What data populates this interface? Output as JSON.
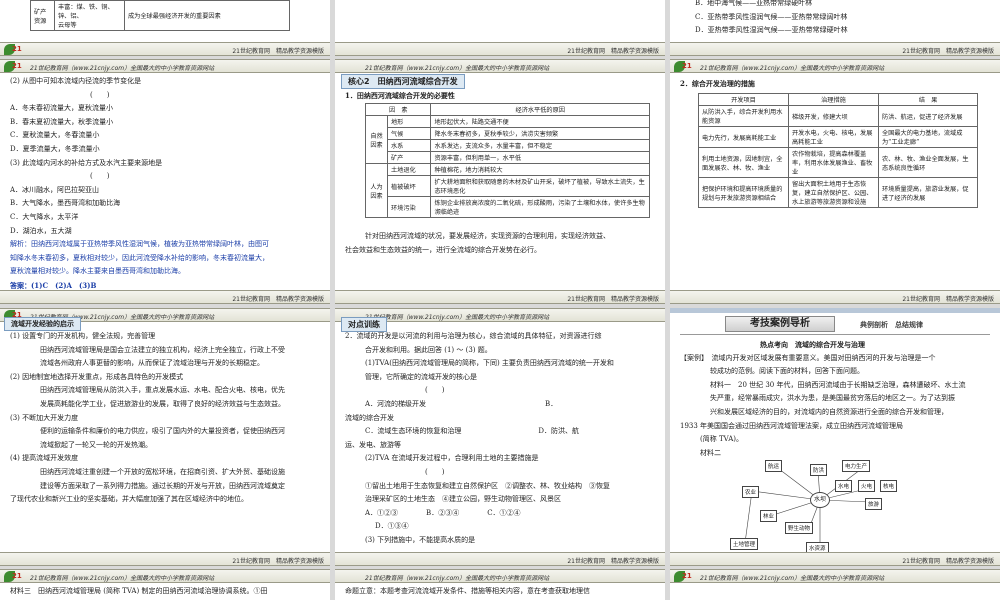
{
  "banner": {
    "logo_text": "21",
    "url": "21世纪教育网（www.21cnjy.com）全国最大的中小学教育资源网站",
    "right": "21世纪教育网　精品教学资源模版"
  },
  "s1": {
    "row_a": "矿产",
    "row_b": "资源",
    "row_c": "丰富：煤、铁、铜、锌、铝、",
    "row_d": "云母等",
    "row_e": "成为全球最强经济开发的重要因素"
  },
  "s2": {
    "lines": [
      "B．地中海气候——亚热带常绿硬叶林",
      "C．亚热带季风性湿润气候——亚热带常绿阔叶林",
      "D．亚热带季风性湿润气候——亚热带常绿硬叶林"
    ]
  },
  "s3": {
    "lines": [
      "(2) 从图中可知本流域内径流的季节变化是",
      "(　　)",
      "A．冬末春初流量大，夏秋流量小",
      "B．春末夏初流量大，秋季流量小",
      "C．夏秋流量大，冬春流量小",
      "D．夏季流量大，冬季流量小",
      "(3) 此流域内河水的补给方式及水汽主要来源地是",
      "(　　)",
      "A．冰川融水，阿巴拉契亚山",
      "B．大气降水，墨西哥湾和加勒比海",
      "C．大气降水，太平洋",
      "D．湖泊水，五大湖",
      "解析：田纳西河流域属于亚热带季风性湿润气候，植被为亚热带常绿阔叶林，由图可",
      "知降水冬末春初多，夏秋相对较少，因此河流受降水补给的影响，冬末春初流量大，",
      "夏秋流量相对较少。降水主要来自墨西哥湾和加勒比海。",
      "答案：(1)C　(2)A　(3)B"
    ]
  },
  "s4": {
    "label": "核心2　田纳西河流域综合开发",
    "heading": "1．田纳西河流域综合开发的必要性",
    "table": {
      "h1": "因　素",
      "h2": "经济水平低的原因",
      "g1": "自然因素",
      "g2": "人为因素",
      "rows": [
        [
          "地形",
          "地形起伏大，陆路交通不便"
        ],
        [
          "气候",
          "降水冬末春初多，夏秋季较少，洪涝灾害频繁"
        ],
        [
          "水系",
          "水系发达，支流众多，水量丰富，但不稳定"
        ],
        [
          "矿产",
          "资源丰富，但利用单一，水平低"
        ],
        [
          "土地退化",
          "种植棉花，地力消耗较大"
        ],
        [
          "植被破坏",
          "扩大耕地面积和获取随意的木材及矿山开采，破坏了植被，导致水土流失，生态环境恶化"
        ],
        [
          "环境污染",
          "炼铜企业排放高浓度的二氧化硫，形成酸雨，污染了土壤和水体，使许多生物濒临绝迹"
        ]
      ]
    },
    "after": [
      "针对田纳西河流域的状况，要发展经济，实现资源的合理利用，实现经济效益、",
      "社会效益和生态效益的统一，进行全流域的综合开发势在必行。"
    ]
  },
  "s5": {
    "heading": "2．综合开发治理的措施",
    "table": {
      "h": [
        "开发项目",
        "治理措施",
        "结　果"
      ],
      "rows": [
        [
          "从防洪入手，综合开发利用水能资源",
          "梯级开发，修建大坝",
          "防洪、航运，促进了经济发展"
        ],
        [
          "电力先行，发展高耗能工业",
          "开发水电，火电、核电，发展高耗能工业",
          "全国最大的电力基地，流域成为“工业走廊”"
        ],
        [
          "利用土地资源，因地制宜，全面发展农、林、牧、渔业",
          "农作物栽培，提高森林覆盖率，利用水体发展渔业、畜牧业",
          "农、林、牧、渔业全面发展，生态系统良性循环"
        ],
        [
          "把保护环境和提高环境质量的规划与开发旅游资源相结合",
          "留出大面积土地用于生态恢复，建立自然保护区、公园、水上旅游等旅游资源和设施",
          "环境质量提高，旅游业发展，促进了经济的发展"
        ]
      ]
    }
  },
  "s6": {
    "label": "流域开发经验的启示",
    "lines": [
      "(1) 设置专门的开发机构，健全法规，完善管理",
      "田纳西河流域管理局是国会立法建立的独立机构，经济上完全独立，行政上不受",
      "流域各州政府人事更替的影响，从而保证了流域治理与开发的长期稳定。",
      "(2) 因地制宜地选择开发重点，形成各具特色的开发模式",
      "田纳西河流域管理局从防洪入手，重点发展水运、水电、配合火电、核电，优先",
      "发展高耗能化学工业，促进旅游业的发展，取得了良好的经济效益与生态效益。",
      "(3) 不断加大开发力度",
      "便利的运输条件和廉价的电力供应，吸引了国内外的大量投资者，促使田纳西河",
      "流域掀起了一轮又一轮的开发热潮。",
      "(4) 提高流域开发效度",
      "田纳西河流域注重创建一个开放的宽松环境，在招商引资、扩大外贸、基础设施",
      "建设等方面采取了一系列得力措施。通过长期的开发与开放，田纳西河流域奠定",
      "了现代农业和新兴工业的坚实基础，并大幅度加强了其在区域经济中的地位。"
    ]
  },
  "s7": {
    "label": "对点训练",
    "lines": [
      "2．流域的开发是以河流的利用与治理为核心，综合流域的具体特征，对资源进行综",
      "合开发和利用。据此回答 (1) ～ (3) 题。",
      "(1)TVA(田纳西河流域管理局的简称，下同) 主要负责田纳西河流域的统一开发和",
      "管理，它所确定的流域开发的核心是",
      "(　　)",
      "A．河流的梯级开发　　　　　　　　　　　　　　　　　B．",
      "流域的综合开发",
      "C．流域生态环境的恢复和治理　　　　　　　　　　　D．防洪、航",
      "运、发电、旅游等",
      "(2)TVA 在流域开发过程中，合理利用土地的主要措施是",
      "(　　)",
      "①留出土地用于生态恢复和建立自然保护区　②调整农、林、牧业结构　③恢复",
      "治理采矿区的土地生态　④建立公园，野生动物管理区、风景区",
      "A．①②③　　　　B．②③④　　　　C．①②④",
      "D．①③④",
      "(3) 下列措施中，不能提高水质的是"
    ]
  },
  "s8": {
    "title": "考技案例导析",
    "tag": "典例剖析　总结规律",
    "subhead": "热点考向　流域的综合开发与治理",
    "lines": [
      "【案例】　流域内开发对区域发展有重要意义。美国对田纳西河的开发与治理是一个",
      "较成功的范例。阅读下面的材料，回答下面问题。",
      "材料一　20 世纪 30 年代，田纳西河流域由于长期缺乏治理，森林遭破坏、水土流",
      "失严重，经常暴雨成灾，洪水为患，是美国最贫穷落后的地区之一。为了达到振",
      "兴和发展区域经济的目的，对流域内的自然资源进行全面的综合开发和管理，",
      "1933 年美国国会通过田纳西河流域管理法案，成立田纳西河流域管理局",
      "(简称 TVA)。",
      "材料二"
    ],
    "diagram": {
      "center": "水坝",
      "nodes": [
        "航运",
        "防洪",
        "电力生产",
        "水电",
        "火电",
        "核电",
        "农业",
        "林业",
        "野生动物",
        "土地管理",
        "水资源",
        "旅游"
      ]
    }
  },
  "s9": {
    "line": "材料三　田纳西河流域管理局 (简称 TVA) 制定的田纳西河流域治理协调系统。①田"
  },
  "s10": {
    "line": "命题立意：本题考查河流流域开发条件、措施等相关内容，意在考查获取地理信"
  }
}
